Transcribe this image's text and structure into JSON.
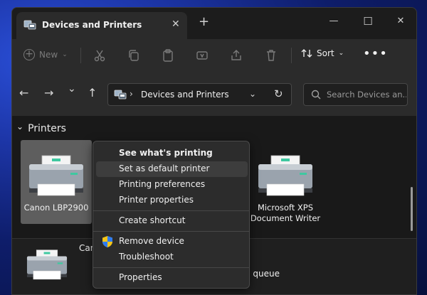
{
  "window": {
    "tab_title": "Devices and Printers",
    "close_glyph": "✕",
    "new_tab_glyph": "+",
    "minimize_glyph": "—",
    "maximize_glyph": "☐",
    "window_close_glyph": "✕"
  },
  "toolbar": {
    "new_label": "New",
    "sort_label": "Sort",
    "more_glyph": "•••",
    "icons": [
      "cut-icon",
      "copy-icon",
      "paste-icon",
      "rename-icon",
      "share-icon",
      "delete-icon"
    ]
  },
  "navbar": {
    "back_glyph": "←",
    "forward_glyph": "→",
    "recent_glyph": "⌄",
    "up_glyph": "↑",
    "address_separator": "›",
    "address_text": "Devices and Printers",
    "address_dropdown_glyph": "⌄",
    "refresh_glyph": "↻",
    "search_placeholder": "Search Devices an..."
  },
  "content": {
    "group_header": "Printers",
    "group_chevron": "⌄",
    "devices": [
      {
        "label": "Canon LBP2900",
        "selected": true
      },
      {
        "label": "Microsoft XPS Document Writer",
        "selected": false
      }
    ],
    "details": {
      "name_partial": "Can",
      "queue_partial": "n queue"
    }
  },
  "context_menu": {
    "items": [
      {
        "label": "See what's printing",
        "bold": true
      },
      {
        "label": "Set as default printer",
        "hover": true
      },
      {
        "label": "Printing preferences"
      },
      {
        "label": "Printer properties"
      },
      {
        "label": "Create shortcut"
      },
      {
        "label": "Remove device",
        "icon": "shield-icon"
      },
      {
        "label": "Troubleshoot"
      },
      {
        "label": "Properties"
      }
    ]
  },
  "colors": {
    "printer_accent": "#3fc8a0",
    "selection": "#5e5e5e",
    "shield_blue": "#2f7cf0",
    "shield_yellow": "#f5c518"
  }
}
